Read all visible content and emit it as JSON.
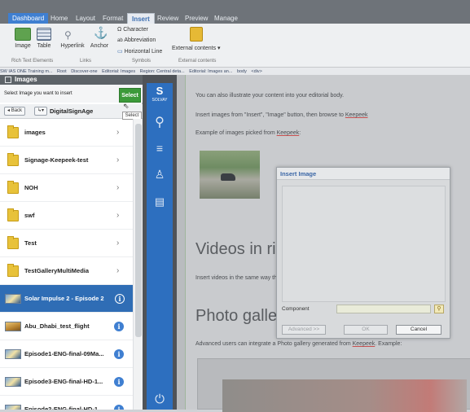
{
  "ribbon": {
    "tabs": [
      "Dashboard",
      "Home",
      "Layout",
      "Format",
      "Insert",
      "Review",
      "Preview",
      "Manage"
    ],
    "active_tab": "Insert",
    "groups": {
      "rich_text": {
        "label": "Rich Text Elements",
        "buttons": [
          "Image",
          "Table"
        ]
      },
      "links": {
        "label": "Links",
        "buttons": [
          "Hyperlink",
          "Anchor"
        ]
      },
      "symbols": {
        "label": "Symbols",
        "buttons": [
          "Character",
          "Abbreviation",
          "Horizontal Line"
        ]
      },
      "external": {
        "label": "External contents",
        "buttons": [
          "External contents"
        ]
      }
    }
  },
  "breadcrumb": [
    "SW IAS ONE Training m...",
    "Root",
    "Discover-one",
    "Editorial: Images",
    "Region: Central deta...",
    "Editorial: Images an...",
    "body",
    "<div>"
  ],
  "panel": {
    "title": "Images",
    "instruction": "Select Image you want to insert",
    "select_label": "Select",
    "tooltip": "Select",
    "back_label": "Back",
    "current_folder": "DigitalSignAge",
    "items": [
      {
        "type": "folder",
        "name": "images"
      },
      {
        "type": "folder",
        "name": "Signage-Keepeek-test"
      },
      {
        "type": "folder",
        "name": "NOH"
      },
      {
        "type": "folder",
        "name": "swf"
      },
      {
        "type": "folder",
        "name": "Test"
      },
      {
        "type": "folder",
        "name": "TestGalleryMultiMedia"
      },
      {
        "type": "video",
        "name": "Solar Impulse 2 - Episode 2",
        "selected": true
      },
      {
        "type": "image",
        "name": "Abu_Dhabi_test_flight"
      },
      {
        "type": "video",
        "name": "Episode1-ENG-final-09Ma..."
      },
      {
        "type": "video",
        "name": "Episode3-ENG-final-HD-1..."
      },
      {
        "type": "video",
        "name": "Episode2-ENG-final-HD-1..."
      }
    ]
  },
  "appbar": {
    "brand": "SOLVAY",
    "brand_initial": "S"
  },
  "content": {
    "p1": "You can also illustrate your content into your editorial body.",
    "p2_pre": "Insert images from \"Insert\", \"Image\" button, then browse to ",
    "p2_link": "Keepeek",
    "p3_pre": "Example of images picked from ",
    "p3_link": "Keepeek",
    "h_videos": "Videos in ri",
    "p4": "Insert videos in the same way th",
    "h_photo": "Photo galle",
    "p5_pre": "Advanced users can integrate a Photo gallery generated from ",
    "p5_link": "Keepeek",
    "p5_post": ". Example:"
  },
  "dialog": {
    "title": "Insert Image",
    "component_label": "Component",
    "advanced_label": "Advanced >>",
    "ok_label": "OK",
    "cancel_label": "Cancel"
  },
  "colors": {
    "accent": "#2f6db5",
    "select_green": "#3c9a3a",
    "navbar_blue": "#2d6fbf"
  }
}
